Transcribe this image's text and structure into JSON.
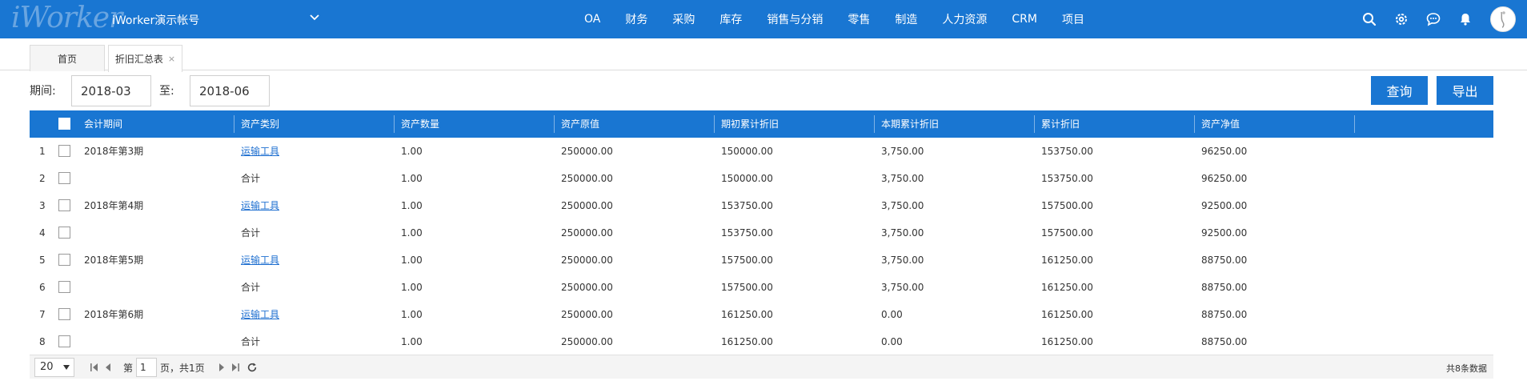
{
  "app": {
    "logo_text": "iWorker",
    "account_name": "iWorker演示帐号"
  },
  "nav": [
    "OA",
    "财务",
    "采购",
    "库存",
    "销售与分销",
    "零售",
    "制造",
    "人力资源",
    "CRM",
    "项目"
  ],
  "tabs": {
    "home": "首页",
    "active": "折旧汇总表",
    "close_symbol": "×"
  },
  "filter": {
    "period_label": "期间:",
    "start_value": "2018-03",
    "to_label": "至:",
    "end_value": "2018-06",
    "query_button": "查询",
    "export_button": "导出"
  },
  "table": {
    "columns": [
      "会计期间",
      "资产类别",
      "资产数量",
      "资产原值",
      "期初累计折旧",
      "本期累计折旧",
      "累计折旧",
      "资产净值"
    ],
    "rows": [
      {
        "num": "1",
        "period": "2018年第3期",
        "category": "运输工具",
        "is_link": true,
        "qty": "1.00",
        "original": "250000.00",
        "opening": "150000.00",
        "current": "3,750.00",
        "accum": "153750.00",
        "net": "96250.00"
      },
      {
        "num": "2",
        "period": "",
        "category": "合计",
        "is_link": false,
        "qty": "1.00",
        "original": "250000.00",
        "opening": "150000.00",
        "current": "3,750.00",
        "accum": "153750.00",
        "net": "96250.00"
      },
      {
        "num": "3",
        "period": "2018年第4期",
        "category": "运输工具",
        "is_link": true,
        "qty": "1.00",
        "original": "250000.00",
        "opening": "153750.00",
        "current": "3,750.00",
        "accum": "157500.00",
        "net": "92500.00"
      },
      {
        "num": "4",
        "period": "",
        "category": "合计",
        "is_link": false,
        "qty": "1.00",
        "original": "250000.00",
        "opening": "153750.00",
        "current": "3,750.00",
        "accum": "157500.00",
        "net": "92500.00"
      },
      {
        "num": "5",
        "period": "2018年第5期",
        "category": "运输工具",
        "is_link": true,
        "qty": "1.00",
        "original": "250000.00",
        "opening": "157500.00",
        "current": "3,750.00",
        "accum": "161250.00",
        "net": "88750.00"
      },
      {
        "num": "6",
        "period": "",
        "category": "合计",
        "is_link": false,
        "qty": "1.00",
        "original": "250000.00",
        "opening": "157500.00",
        "current": "3,750.00",
        "accum": "161250.00",
        "net": "88750.00"
      },
      {
        "num": "7",
        "period": "2018年第6期",
        "category": "运输工具",
        "is_link": true,
        "qty": "1.00",
        "original": "250000.00",
        "opening": "161250.00",
        "current": "0.00",
        "accum": "161250.00",
        "net": "88750.00"
      },
      {
        "num": "8",
        "period": "",
        "category": "合计",
        "is_link": false,
        "qty": "1.00",
        "original": "250000.00",
        "opening": "161250.00",
        "current": "0.00",
        "accum": "161250.00",
        "net": "88750.00"
      }
    ]
  },
  "pager": {
    "page_size": "20",
    "page_prefix": "第",
    "current_page": "1",
    "page_suffix": "页，共1页",
    "total_text": "共8条数据"
  },
  "colors": {
    "primary": "#1976d2",
    "link": "#1e6fd0"
  },
  "icons": {
    "top": [
      "search-icon",
      "gear-icon",
      "chat-icon",
      "bell-icon"
    ]
  }
}
